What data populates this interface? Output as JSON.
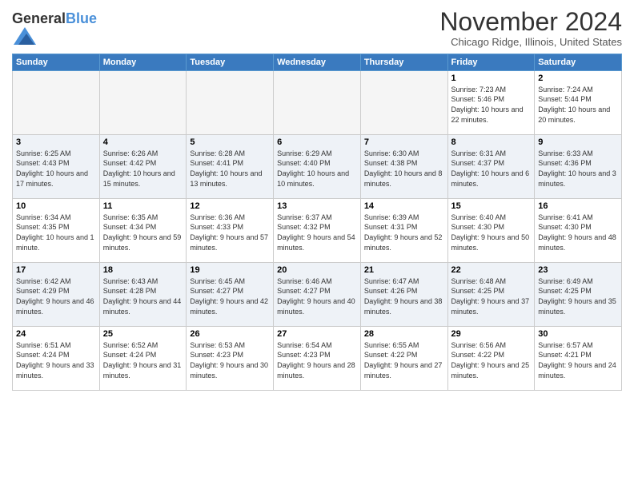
{
  "logo": {
    "general": "General",
    "blue": "Blue"
  },
  "title": "November 2024",
  "location": "Chicago Ridge, Illinois, United States",
  "days_of_week": [
    "Sunday",
    "Monday",
    "Tuesday",
    "Wednesday",
    "Thursday",
    "Friday",
    "Saturday"
  ],
  "weeks": [
    [
      {
        "day": "",
        "info": ""
      },
      {
        "day": "",
        "info": ""
      },
      {
        "day": "",
        "info": ""
      },
      {
        "day": "",
        "info": ""
      },
      {
        "day": "",
        "info": ""
      },
      {
        "day": "1",
        "info": "Sunrise: 7:23 AM\nSunset: 5:46 PM\nDaylight: 10 hours and 22 minutes."
      },
      {
        "day": "2",
        "info": "Sunrise: 7:24 AM\nSunset: 5:44 PM\nDaylight: 10 hours and 20 minutes."
      }
    ],
    [
      {
        "day": "3",
        "info": "Sunrise: 6:25 AM\nSunset: 4:43 PM\nDaylight: 10 hours and 17 minutes."
      },
      {
        "day": "4",
        "info": "Sunrise: 6:26 AM\nSunset: 4:42 PM\nDaylight: 10 hours and 15 minutes."
      },
      {
        "day": "5",
        "info": "Sunrise: 6:28 AM\nSunset: 4:41 PM\nDaylight: 10 hours and 13 minutes."
      },
      {
        "day": "6",
        "info": "Sunrise: 6:29 AM\nSunset: 4:40 PM\nDaylight: 10 hours and 10 minutes."
      },
      {
        "day": "7",
        "info": "Sunrise: 6:30 AM\nSunset: 4:38 PM\nDaylight: 10 hours and 8 minutes."
      },
      {
        "day": "8",
        "info": "Sunrise: 6:31 AM\nSunset: 4:37 PM\nDaylight: 10 hours and 6 minutes."
      },
      {
        "day": "9",
        "info": "Sunrise: 6:33 AM\nSunset: 4:36 PM\nDaylight: 10 hours and 3 minutes."
      }
    ],
    [
      {
        "day": "10",
        "info": "Sunrise: 6:34 AM\nSunset: 4:35 PM\nDaylight: 10 hours and 1 minute."
      },
      {
        "day": "11",
        "info": "Sunrise: 6:35 AM\nSunset: 4:34 PM\nDaylight: 9 hours and 59 minutes."
      },
      {
        "day": "12",
        "info": "Sunrise: 6:36 AM\nSunset: 4:33 PM\nDaylight: 9 hours and 57 minutes."
      },
      {
        "day": "13",
        "info": "Sunrise: 6:37 AM\nSunset: 4:32 PM\nDaylight: 9 hours and 54 minutes."
      },
      {
        "day": "14",
        "info": "Sunrise: 6:39 AM\nSunset: 4:31 PM\nDaylight: 9 hours and 52 minutes."
      },
      {
        "day": "15",
        "info": "Sunrise: 6:40 AM\nSunset: 4:30 PM\nDaylight: 9 hours and 50 minutes."
      },
      {
        "day": "16",
        "info": "Sunrise: 6:41 AM\nSunset: 4:30 PM\nDaylight: 9 hours and 48 minutes."
      }
    ],
    [
      {
        "day": "17",
        "info": "Sunrise: 6:42 AM\nSunset: 4:29 PM\nDaylight: 9 hours and 46 minutes."
      },
      {
        "day": "18",
        "info": "Sunrise: 6:43 AM\nSunset: 4:28 PM\nDaylight: 9 hours and 44 minutes."
      },
      {
        "day": "19",
        "info": "Sunrise: 6:45 AM\nSunset: 4:27 PM\nDaylight: 9 hours and 42 minutes."
      },
      {
        "day": "20",
        "info": "Sunrise: 6:46 AM\nSunset: 4:27 PM\nDaylight: 9 hours and 40 minutes."
      },
      {
        "day": "21",
        "info": "Sunrise: 6:47 AM\nSunset: 4:26 PM\nDaylight: 9 hours and 38 minutes."
      },
      {
        "day": "22",
        "info": "Sunrise: 6:48 AM\nSunset: 4:25 PM\nDaylight: 9 hours and 37 minutes."
      },
      {
        "day": "23",
        "info": "Sunrise: 6:49 AM\nSunset: 4:25 PM\nDaylight: 9 hours and 35 minutes."
      }
    ],
    [
      {
        "day": "24",
        "info": "Sunrise: 6:51 AM\nSunset: 4:24 PM\nDaylight: 9 hours and 33 minutes."
      },
      {
        "day": "25",
        "info": "Sunrise: 6:52 AM\nSunset: 4:24 PM\nDaylight: 9 hours and 31 minutes."
      },
      {
        "day": "26",
        "info": "Sunrise: 6:53 AM\nSunset: 4:23 PM\nDaylight: 9 hours and 30 minutes."
      },
      {
        "day": "27",
        "info": "Sunrise: 6:54 AM\nSunset: 4:23 PM\nDaylight: 9 hours and 28 minutes."
      },
      {
        "day": "28",
        "info": "Sunrise: 6:55 AM\nSunset: 4:22 PM\nDaylight: 9 hours and 27 minutes."
      },
      {
        "day": "29",
        "info": "Sunrise: 6:56 AM\nSunset: 4:22 PM\nDaylight: 9 hours and 25 minutes."
      },
      {
        "day": "30",
        "info": "Sunrise: 6:57 AM\nSunset: 4:21 PM\nDaylight: 9 hours and 24 minutes."
      }
    ]
  ]
}
